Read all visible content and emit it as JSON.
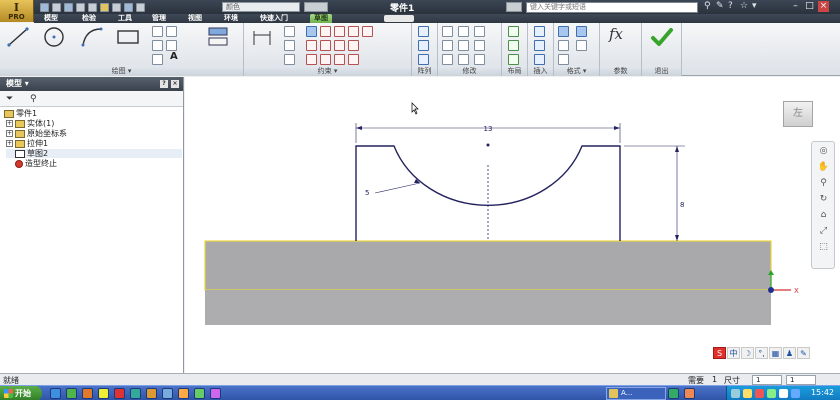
{
  "app": {
    "logo_text": "I",
    "logo_sub": "PRO",
    "doc_title": "零件1",
    "material_field": "颜色",
    "search_placeholder": "键入关键字或短语"
  },
  "menu_tabs": [
    "模型",
    "检验",
    "工具",
    "管理",
    "视图",
    "环境",
    "快速入门",
    "草图"
  ],
  "active_tab": "草图",
  "ribbon_panels": [
    {
      "label": "绘图 ▾"
    },
    {
      "label": "约束 ▾"
    },
    {
      "label": "阵列"
    },
    {
      "label": "修改"
    },
    {
      "label": "布局"
    },
    {
      "label": "插入"
    },
    {
      "label": "格式 ▾"
    },
    {
      "label": "参数"
    },
    {
      "label": "退出"
    }
  ],
  "ribbon_text": {
    "text_tool": "A",
    "fx": "fx"
  },
  "browser": {
    "title": "模型 ▾",
    "tree": [
      {
        "label": "零件1",
        "icon": "part-icon",
        "expand": ""
      },
      {
        "label": "实体(1)",
        "icon": "solid-body-icon",
        "expand": "+"
      },
      {
        "label": "原始坐标系",
        "icon": "folder-icon",
        "expand": "+"
      },
      {
        "label": "拉伸1",
        "icon": "extrude-icon",
        "expand": "+"
      },
      {
        "label": "草图2",
        "icon": "sketch-icon",
        "expand": ""
      },
      {
        "label": "造型终止",
        "icon": "end-of-part-icon",
        "expand": ""
      }
    ]
  },
  "canvas": {
    "viewcube_label": "左",
    "dimension_width": "13",
    "dimension_height": "8",
    "dimension_radius": "5",
    "axis_x": "X"
  },
  "status": {
    "text": "就绪",
    "need_label": "需要",
    "need_value": "1",
    "size_label": "尺寸",
    "size_value": "1",
    "extra_value": "1"
  },
  "taskbar": {
    "start_label": "开始",
    "app_label": "A...",
    "clock": "15:42"
  },
  "ime": [
    "S",
    "中",
    "☽",
    "°,",
    "▦",
    "♟",
    "✎"
  ]
}
